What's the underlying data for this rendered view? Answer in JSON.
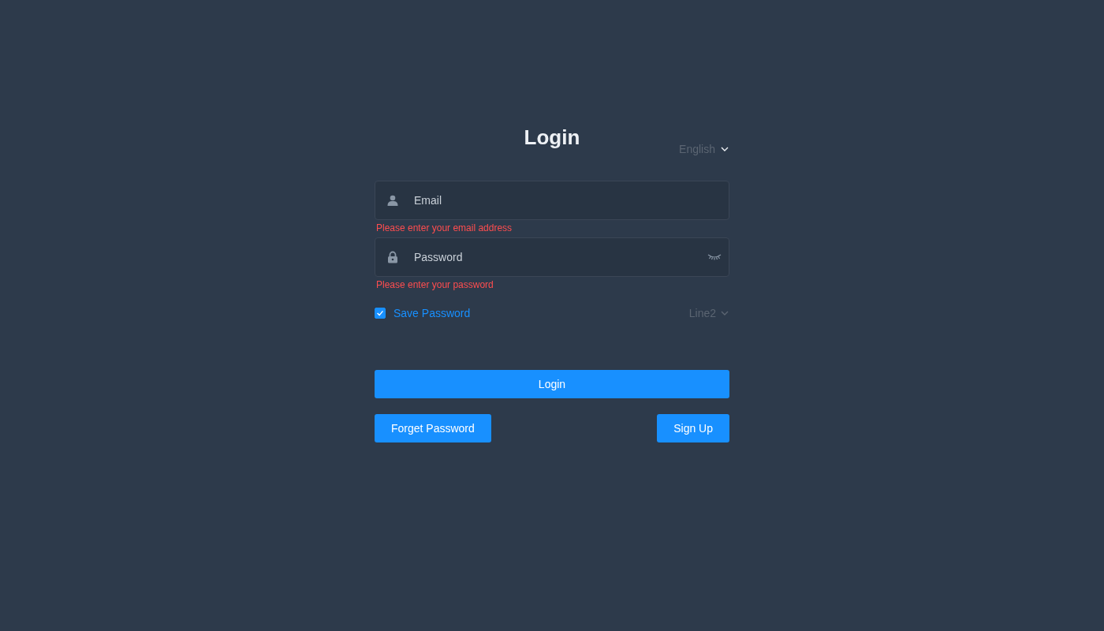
{
  "title": "Login",
  "language": {
    "label": "English"
  },
  "fields": [
    {
      "kind": "email",
      "placeholder": "Email",
      "error": "Please enter your email address"
    },
    {
      "kind": "password",
      "placeholder": "Password",
      "error": "Please enter your password"
    }
  ],
  "save_password": {
    "label": "Save Password",
    "checked": true
  },
  "line": {
    "label": "Line2"
  },
  "login_button": "Login",
  "buttons": [
    "Forget Password",
    "Sign Up"
  ]
}
